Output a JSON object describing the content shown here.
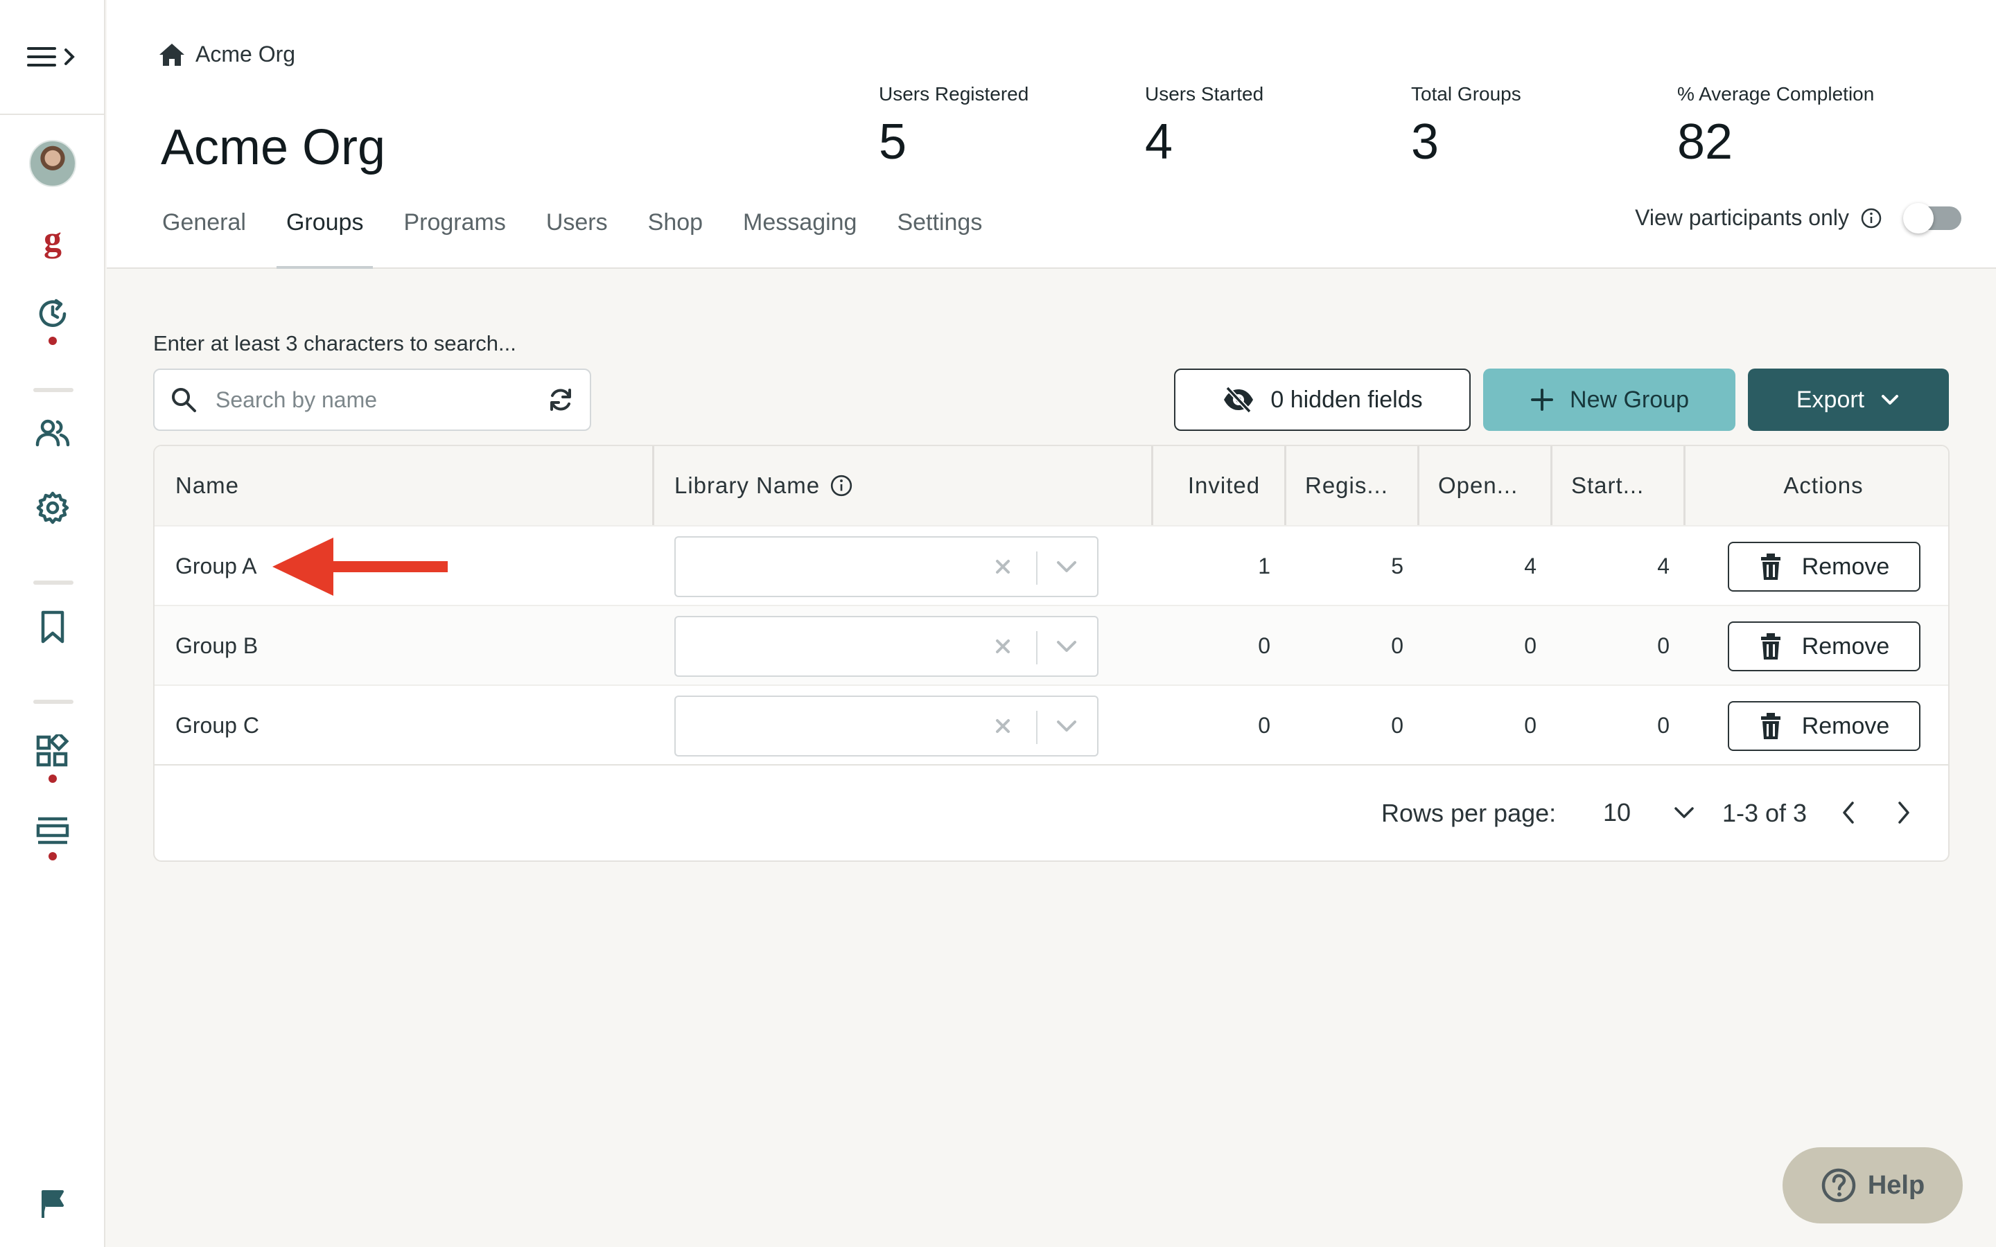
{
  "breadcrumb": {
    "label": "Acme Org"
  },
  "page": {
    "title": "Acme Org"
  },
  "stats": [
    {
      "label": "Users Registered",
      "value": "5"
    },
    {
      "label": "Users Started",
      "value": "4"
    },
    {
      "label": "Total Groups",
      "value": "3"
    },
    {
      "label": "% Average Completion",
      "value": "82"
    }
  ],
  "tabs": [
    "General",
    "Groups",
    "Programs",
    "Users",
    "Shop",
    "Messaging",
    "Settings"
  ],
  "active_tab": "Groups",
  "participants_toggle": {
    "label": "View participants only",
    "on": false
  },
  "search": {
    "label": "Enter at least 3 characters to search...",
    "placeholder": "Search by name"
  },
  "toolbar": {
    "hidden_fields": "0 hidden fields",
    "new_group": "New Group",
    "export": "Export"
  },
  "table": {
    "columns": [
      "Name",
      "Library Name",
      "Invited",
      "Regis...",
      "Open...",
      "Start...",
      "Actions"
    ],
    "rows": [
      {
        "name": "Group A",
        "invited": "1",
        "registered": "5",
        "opened": "4",
        "started": "4"
      },
      {
        "name": "Group B",
        "invited": "0",
        "registered": "0",
        "opened": "0",
        "started": "0"
      },
      {
        "name": "Group C",
        "invited": "0",
        "registered": "0",
        "opened": "0",
        "started": "0"
      }
    ],
    "remove_label": "Remove"
  },
  "pagination": {
    "rows_per_page_label": "Rows per page:",
    "rows_per_page": "10",
    "range": "1-3 of 3"
  },
  "help": {
    "label": "Help"
  },
  "colors": {
    "accent_teal": "#76bfc3",
    "dark_teal": "#2b5c62",
    "brand_red": "#b3272d",
    "annotation_arrow": "#e63b27"
  }
}
